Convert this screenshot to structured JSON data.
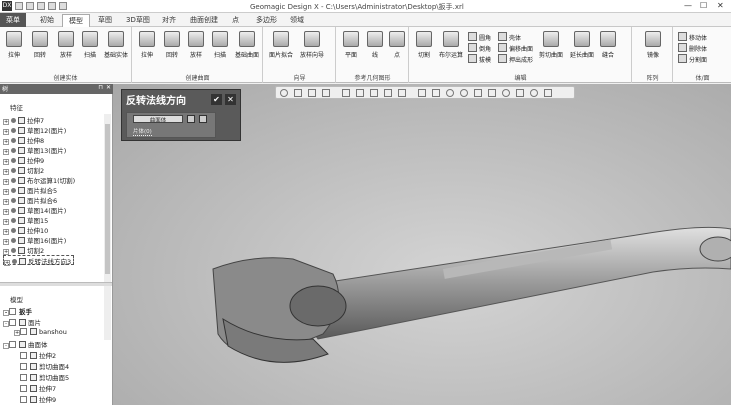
{
  "titlebar": {
    "logo": "DX",
    "title": "Geomagic Design X - C:\\Users\\Administrator\\Desktop\\扳手.xrl",
    "min": "—",
    "max": "☐",
    "close": "✕"
  },
  "menu": {
    "file": "菜单",
    "tabs": [
      "初始",
      "模型",
      "草图",
      "3D草图",
      "对齐",
      "曲面创建",
      "点",
      "多边形",
      "领域"
    ],
    "active_index": 1
  },
  "ribbon": {
    "groups": [
      {
        "title": "创建实体",
        "buttons": [
          "拉伸",
          "回转",
          "放样",
          "扫描",
          "基础实体"
        ]
      },
      {
        "title": "创建曲面",
        "buttons": [
          "拉伸",
          "回转",
          "放样",
          "扫描",
          "基础曲面"
        ]
      },
      {
        "title": "向导",
        "buttons": [
          "面片拟合",
          "放样向导"
        ]
      },
      {
        "title": "参考几何图形",
        "buttons": [
          "平面",
          "线",
          "点"
        ]
      },
      {
        "title": "编辑",
        "buttons": [
          "切割",
          "布尔运算",
          "圆角",
          "倒角",
          "拔模",
          "壳体",
          "偏移曲面",
          "押出成形",
          "剪切曲面",
          "延长曲面",
          "缝合"
        ]
      },
      {
        "title": "阵列",
        "buttons": [
          "镜像"
        ]
      },
      {
        "title": "体/面",
        "buttons": [
          "移动体",
          "删除体",
          "分割面"
        ]
      }
    ]
  },
  "panel": {
    "title": "树",
    "pin": "⊓",
    "close": "✕",
    "feature_caption": "特征",
    "features": [
      "拉伸7",
      "草图12(面片)",
      "拉伸8",
      "草图13(面片)",
      "拉伸9",
      "切割2",
      "布尔运算1(切割)",
      "面片拟合5",
      "面片拟合6",
      "草图14(面片)",
      "草图15",
      "拉伸10",
      "草图16(面片)",
      "切割2",
      "反转法线方向3"
    ],
    "model_caption": "模型",
    "model_rows": [
      "扳手",
      "面片",
      "banshou",
      "曲面体",
      "拉伸2",
      "剪切曲面4",
      "剪切曲面5",
      "拉伸7",
      "拉伸9"
    ]
  },
  "dialog": {
    "title": "反转法线方向",
    "ok": "✔",
    "cancel": "✕",
    "field": "曲面体",
    "sub": "片体(0)"
  }
}
